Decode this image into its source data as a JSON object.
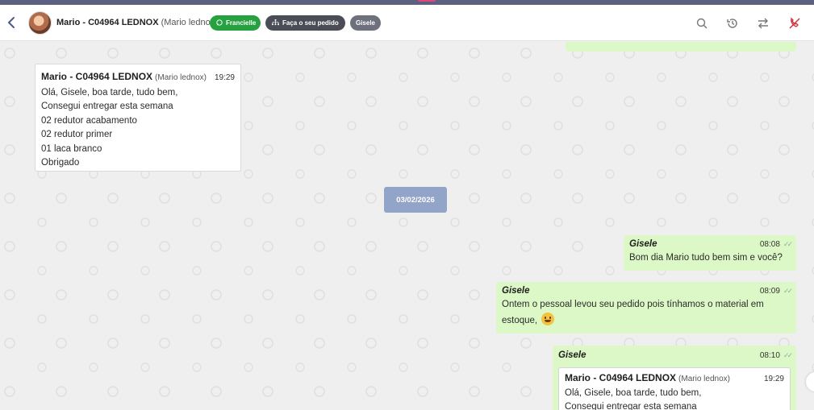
{
  "header": {
    "back_icon": "chevron-left-icon",
    "contact_name": "Mario - C04964 LEDNOX",
    "contact_sub": "(Mario lednox)",
    "tags": [
      {
        "label": "Francielle",
        "icon": "whatsapp-icon",
        "color": "#25a140"
      },
      {
        "label": "Faça o seu pedido",
        "icon": "org-chart-icon",
        "color": "#4a4d55"
      },
      {
        "label": "Gisele",
        "color": "#6d717c"
      }
    ],
    "actions": [
      "search-icon",
      "history-icon",
      "transfer-icon",
      "end-call-icon"
    ]
  },
  "messages": {
    "incoming_1": {
      "name": "Mario - C04964 LEDNOX",
      "sub": "(Mario lednox)",
      "time": "19:29",
      "lines": [
        "Olá, Gisele, boa tarde, tudo bem,",
        "Consegui entregar esta semana",
        "02 redutor acabamento",
        "02 redutor primer",
        "01 laca branco",
        "Obrigado"
      ]
    },
    "date_divider": "03/02/2026",
    "outgoing_1": {
      "sender": "Gisele",
      "time": "08:08",
      "text": "Bom dia Mario tudo bem sim e você?"
    },
    "outgoing_2": {
      "sender": "Gisele",
      "time": "08:09",
      "text": "Ontem o pessoal levou seu pedido pois tínhamos o material em estoque,"
    },
    "outgoing_3": {
      "sender": "Gisele",
      "time": "08:10",
      "quote": {
        "name": "Mario - C04964 LEDNOX",
        "sub": "(Mario lednox)",
        "time": "19:29",
        "lines": [
          "Olá, Gisele, boa tarde, tudo bem,",
          "Consegui entregar esta semana"
        ]
      }
    }
  },
  "colors": {
    "incoming": "#ffffff",
    "outgoing": "#dcf8c6",
    "date_chip": "#93a4c9",
    "accent_red": "#d0303a"
  }
}
